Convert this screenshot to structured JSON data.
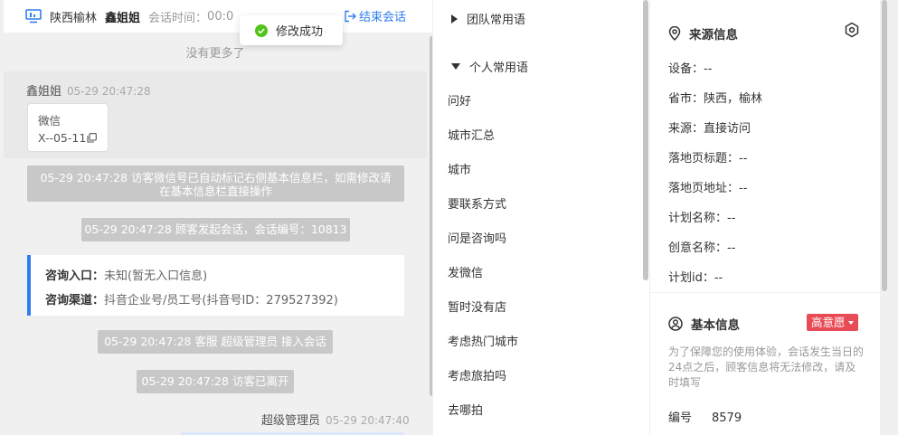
{
  "header": {
    "location": "陕西榆林",
    "visitor_name": "鑫姐姐",
    "session_time_label": "会话时间：",
    "session_time_value": "00:0",
    "end_session_label": "结束会话"
  },
  "toast": {
    "text": "修改成功"
  },
  "chat": {
    "no_more": "没有更多了",
    "visitor_msg": {
      "sender": "鑫姐姐",
      "time": "05-29 20:47:28",
      "card_line1": "微信",
      "card_line2": "X--05-11"
    },
    "system_1_line1": "05-29 20:47:28 访客微信号已自动标记右侧基本信息栏，如需修改请",
    "system_1_line2": "在基本信息栏直接操作",
    "system_2": "05-29 20:47:28 顾客发起会话，会话编号：10813",
    "consult": {
      "entry_label": "咨询入口：",
      "entry_value": "未知(暂无入口信息)",
      "channel_label": "咨询渠道：",
      "channel_value": "抖音企业号/员工号(抖音号ID：279527392)"
    },
    "system_3": "05-29 20:47:28 客服 超级管理员 接入会话",
    "system_4": "05-29 20:47:28 访客已离开",
    "agent_msg": {
      "sender": "超级管理员",
      "time": "05-29 20:47:40"
    }
  },
  "phrases": {
    "team_group": "团队常用语",
    "personal_group": "个人常用语",
    "items": [
      "问好",
      "城市汇总",
      "城市",
      "要联系方式",
      "问是咨询吗",
      "发微信",
      "暂时没有店",
      "考虑热门城市",
      "考虑旅拍吗",
      "去哪拍"
    ]
  },
  "source_info": {
    "title": "来源信息",
    "device": "设备：--",
    "province_city": "省市：陕西，榆林",
    "source": "来源：直接访问",
    "landing_title": "落地页标题：--",
    "landing_url": "落地页地址：--",
    "plan_name": "计划名称：--",
    "creative_name": "创意名称：--",
    "plan_id": "计划id：--"
  },
  "basic_info": {
    "title": "基本信息",
    "intent_badge": "高意愿",
    "note": "为了保障您的使用体验，会话发生当日的24点之后，顾客信息将无法修改，请及时填写",
    "number_label": "编号",
    "number_value": "8579"
  },
  "colors": {
    "accent": "#2f7ef0",
    "badge": "#e94b56",
    "success": "#52c41a"
  }
}
